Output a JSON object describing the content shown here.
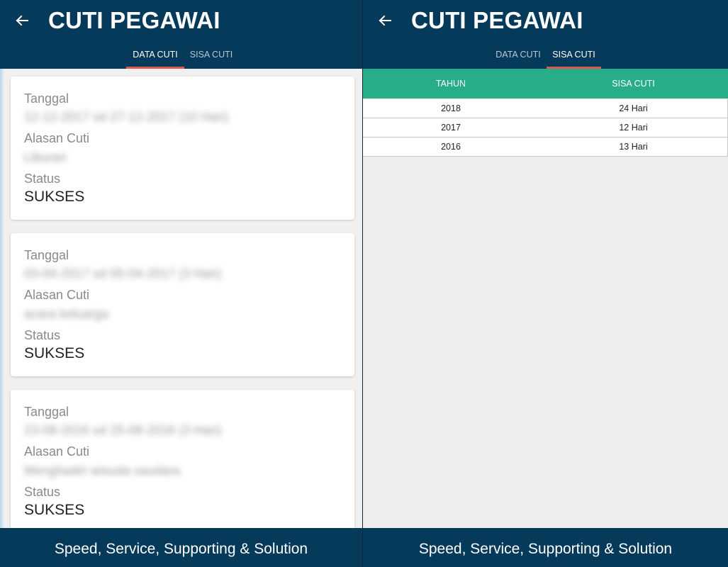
{
  "app": {
    "title": "CUTI PEGAWAI"
  },
  "tabs": {
    "data_cuti": "DATA CUTI",
    "sisa_cuti": "SISA CUTI"
  },
  "labels": {
    "tanggal": "Tanggal",
    "alasan": "Alasan Cuti",
    "status": "Status"
  },
  "leave_records": [
    {
      "tanggal": "12-12-2017 sd 27-12-2017 (10 Hari)",
      "alasan": "Liburan",
      "status": "SUKSES"
    },
    {
      "tanggal": "03-04-2017 sd 05-04-2017 (3 Hari)",
      "alasan": "acara keluarga",
      "status": "SUKSES"
    },
    {
      "tanggal": "23-08-2016 sd 25-08-2016 (3 Hari)",
      "alasan": "Menghadiri wisuda saudara",
      "status": "SUKSES"
    }
  ],
  "sisa_table": {
    "headers": {
      "tahun": "TAHUN",
      "sisa": "SISA CUTI"
    },
    "rows": [
      {
        "tahun": "2018",
        "sisa": "24 Hari"
      },
      {
        "tahun": "2017",
        "sisa": "12 Hari"
      },
      {
        "tahun": "2016",
        "sisa": "13 Hari"
      }
    ]
  },
  "footer": {
    "tagline": "Speed, Service, Supporting & Solution"
  },
  "icons": {
    "back": "arrow-left-icon"
  },
  "colors": {
    "appbar": "#063a5a",
    "tab_indicator": "#e0574f",
    "table_header": "#27ad87"
  }
}
